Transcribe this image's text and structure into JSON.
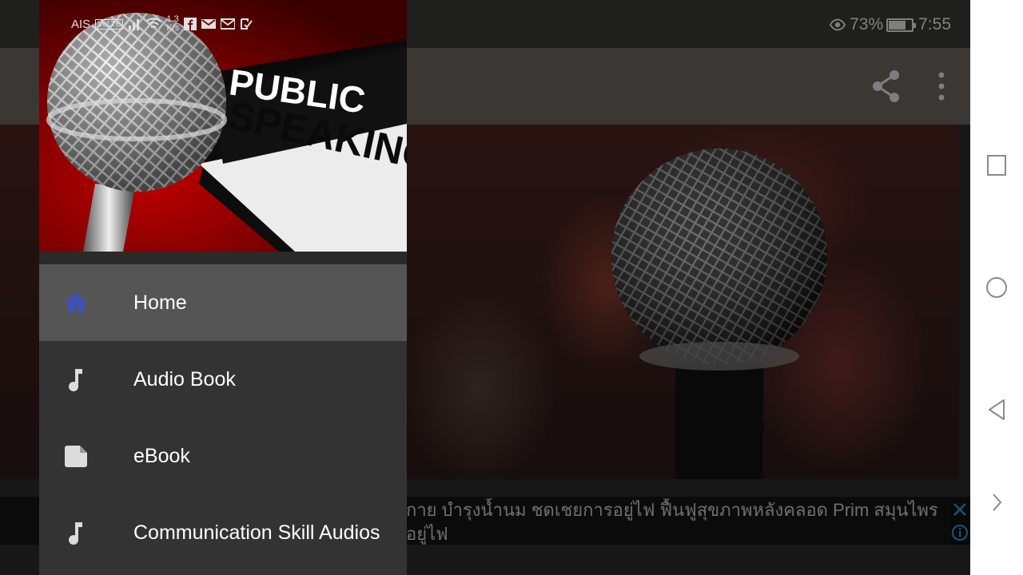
{
  "status_bar": {
    "carrier": "AIS",
    "volte": "VoLTE",
    "speed_value": "1.3",
    "speed_unit": "K/s",
    "battery": "73%",
    "time": "7:55"
  },
  "drawer": {
    "header_text_line1": "PUBLIC",
    "header_text_line2": "SPEAKING",
    "items": [
      {
        "label": "Home",
        "icon": "home-icon",
        "active": true
      },
      {
        "label": "Audio Book",
        "icon": "music-note-icon",
        "active": false
      },
      {
        "label": "eBook",
        "icon": "document-icon",
        "active": false
      },
      {
        "label": "Communication Skill Audios",
        "icon": "music-note-icon",
        "active": false
      }
    ]
  },
  "toolbar": {
    "share_icon": "share-icon",
    "more_icon": "more-vert-icon"
  },
  "ad": {
    "line1": "กาย บำรุงน้ำนม ชดเชยการอยู่ไฟ ฟื้นฟูสุขภาพหลังคลอด Prim สมุนไพร",
    "line2": "อยู่ไฟ"
  },
  "navbar": {
    "buttons": [
      "recents-icon",
      "home-circle-icon",
      "back-icon",
      "expand-icon"
    ]
  },
  "colors": {
    "drawer_bg": "#333333",
    "active_item_bg": "#555555",
    "home_icon_color": "#3f51b5",
    "header_red": "#a00000"
  }
}
